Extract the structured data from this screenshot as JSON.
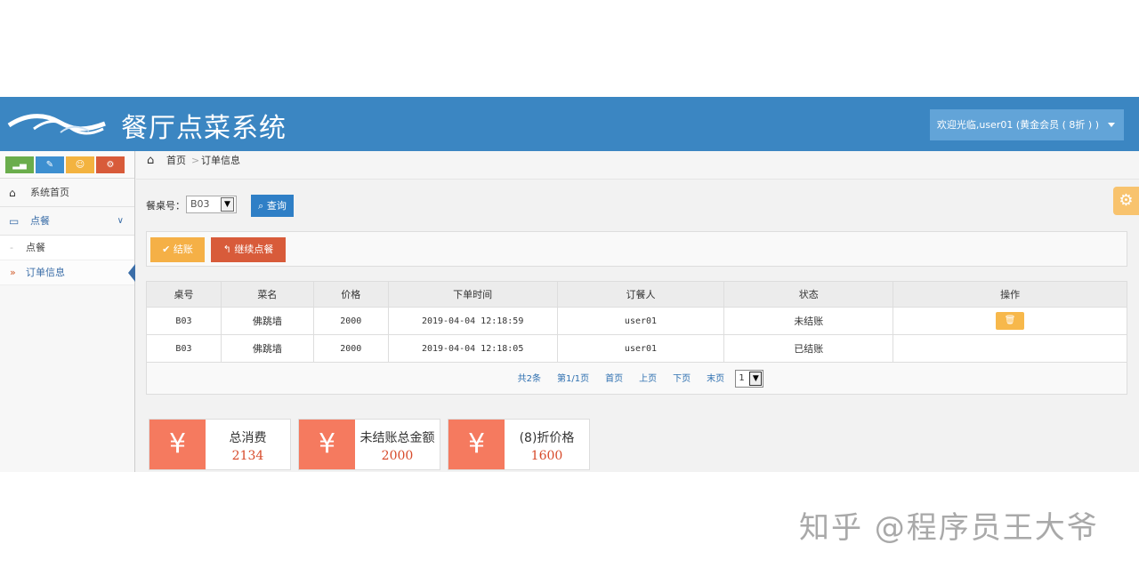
{
  "header": {
    "app_title": "餐厅点菜系统",
    "user_menu": "欢迎光临,user01 (黄金会员 ( 8折 ) )"
  },
  "sidebar": {
    "shortcuts": [
      {
        "icon": "signal-icon",
        "glyph": "▂▄",
        "color": "#6aad4c"
      },
      {
        "icon": "pencil-icon",
        "glyph": "✎",
        "color": "#3d8fd0"
      },
      {
        "icon": "users-icon",
        "glyph": "☺",
        "color": "#f3b340"
      },
      {
        "icon": "cogs-icon",
        "glyph": "⚙",
        "color": "#d85b3a"
      }
    ],
    "items": [
      {
        "label": "系统首页",
        "icon": "home-icon"
      },
      {
        "label": "点餐",
        "icon": "card-icon",
        "chevron": "∨"
      }
    ],
    "sub_items": [
      {
        "label": "点餐"
      },
      {
        "label": "订单信息"
      }
    ]
  },
  "breadcrumb": {
    "home": "首页",
    "separator": ">",
    "current": "订单信息"
  },
  "filter": {
    "label": "餐桌号：",
    "value": "B03",
    "query_button": "查询"
  },
  "actions": {
    "checkout": "✔ 结账",
    "continue": "↰ 继续点餐"
  },
  "table": {
    "headers": [
      "桌号",
      "菜名",
      "价格",
      "下单时间",
      "订餐人",
      "状态",
      "操作"
    ],
    "rows": [
      {
        "table_no": "B03",
        "dish": "佛跳墙",
        "price": "2000",
        "time": "2019-04-04 12:18:59",
        "user": "user01",
        "status": "未结账",
        "action": "🗑"
      },
      {
        "table_no": "B03",
        "dish": "佛跳墙",
        "price": "2000",
        "time": "2019-04-04 12:18:05",
        "user": "user01",
        "status": "已结账",
        "action": ""
      }
    ]
  },
  "pager": {
    "total": "共2条",
    "page_info": "第1/1页",
    "first": "首页",
    "prev": "上页",
    "next": "下页",
    "last": "末页",
    "page": "1"
  },
  "stats": [
    {
      "icon": "¥",
      "label": "总消费",
      "value": "2134"
    },
    {
      "icon": "¥",
      "label": "未结账总金额",
      "value": "2000"
    },
    {
      "icon": "¥",
      "label": "(8)折价格",
      "value": "1600"
    }
  ],
  "watermark": "知乎 @程序员王大爷",
  "colors": {
    "header": "#3b86c2",
    "accent_orange": "#f5b046",
    "accent_red": "#d85b3a",
    "stat_icon": "#f57a5f"
  }
}
